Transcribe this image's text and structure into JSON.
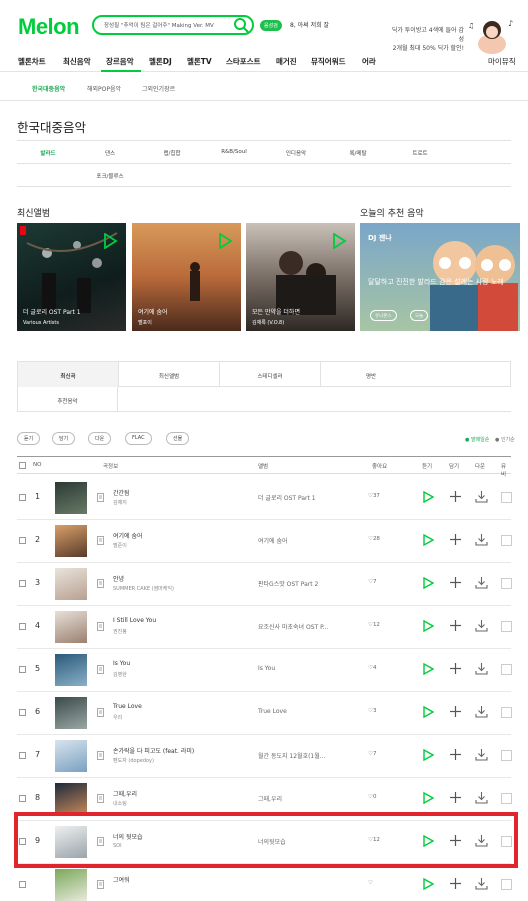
{
  "header": {
    "logo": "Melon",
    "search_text": "장성필 \"추억이 팀은 걸어주\" Making Ver. MV",
    "voice_badge": "음성검",
    "user_name": "8, 아써 저희 잘",
    "promo_line1": "딕가 투이방고 4색에 들어 감성",
    "promo_line2": "2개월 최대 50% 딕가 할인!"
  },
  "gnb": [
    "멜론차트",
    "최신음악",
    "장르음악",
    "멜론DJ",
    "멜론TV",
    "스타포스트",
    "매거진",
    "뮤직어워드",
    "어라"
  ],
  "gnb_right": "마이뮤직",
  "subnav": [
    "한국대중음악",
    "해외POP음악",
    "그외인기장르"
  ],
  "page_title": "한국대중음악",
  "genres": [
    "발라드",
    "댄스",
    "랩/힙합",
    "R&B/Soul",
    "인디음악",
    "록/메탈",
    "트로트",
    "포크/블루스"
  ],
  "sections": {
    "latest": "최신앨범",
    "recommend": "오늘의 추천 음악"
  },
  "albums": [
    {
      "title": "더 글로리 OST Part 1",
      "artist": "Various Artists"
    },
    {
      "title": "여기에 숨어",
      "artist": "벨포이"
    },
    {
      "title": "모든 만약을 더하면",
      "artist": "김재록 (V.O.8)"
    }
  ],
  "dj": {
    "label": "DJ 젠나",
    "text": "달달하고 진진한 발라드 감은 설레는 사랑 노래",
    "btn1": "유니온스",
    "btn2": "오늘"
  },
  "tabs": [
    "최신곡",
    "최신앨범",
    "스테디셀러",
    "명반",
    "추천음악"
  ],
  "toolbar": [
    "듣기",
    "담기",
    "다운",
    "FLAC",
    "선물"
  ],
  "sort": [
    "● 발매일순",
    "● 인기순"
  ],
  "table_head": {
    "no": "NO",
    "song": "곡정보",
    "album": "앨범",
    "like": "좋아요",
    "listen": "듣기",
    "add": "담기",
    "down": "다운",
    "mv": "뮤비"
  },
  "rows": [
    {
      "rank": "1",
      "title": "간간됨",
      "artist": "김예지",
      "album": "더 글로리 OST Part 1",
      "likes": "37"
    },
    {
      "rank": "2",
      "title": "여기에 숨어",
      "artist": "벨준이",
      "album": "여기에 숨어",
      "likes": "28"
    },
    {
      "rank": "3",
      "title": "안녕",
      "artist": "SUMMER CAKE (썸머케익)",
      "album": "판타G스맛 OST Part 2",
      "likes": "7"
    },
    {
      "rank": "4",
      "title": "I Still Love You",
      "artist": "권진봉",
      "album": "요조신사 마초숙녀 OST P...",
      "likes": "12"
    },
    {
      "rank": "5",
      "title": "Is You",
      "artist": "김영완",
      "album": "Is You",
      "likes": "4"
    },
    {
      "rank": "6",
      "title": "True Love",
      "artist": "우리",
      "album": "True Love",
      "likes": "3"
    },
    {
      "rank": "7",
      "title": "손가락을 다 피고도 (feat. 라미)",
      "artist": "펜도자 (dopedoy)",
      "album": "월간 동도지 12월호(1월...",
      "likes": "7"
    },
    {
      "rank": "8",
      "title": "그때,우리",
      "artist": "내소팅",
      "album": "그때,우리",
      "likes": "0"
    },
    {
      "rank": "9",
      "title": "너의 뒷모습",
      "artist": "SOI",
      "album": "너의뒷모습",
      "likes": "12"
    },
    {
      "rank": "",
      "title": "그여워",
      "artist": "",
      "album": "",
      "likes": ""
    }
  ],
  "colors": {
    "brand": "#00cd3c",
    "highlight": "#e0262c"
  }
}
